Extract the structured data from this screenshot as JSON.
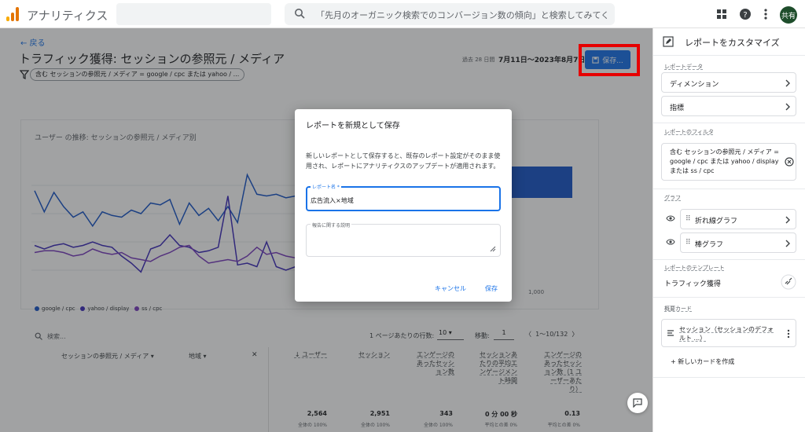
{
  "header": {
    "app_title": "アナリティクス",
    "search_placeholder": "「先月のオーガニック検索でのコンバージョン数の傾向」と検索してみてく...",
    "avatar": "共有"
  },
  "report": {
    "back": "← 戻る",
    "title": "トラフィック獲得: セッションの参照元 / メディア",
    "filter_chip": "含む セッションの参照元 / メディア = google / cpc または yahoo / ...",
    "date_range_label": "過去 28 日間",
    "date_range": "7月11日～2023年8月7日",
    "save_button": "保存..."
  },
  "chart": {
    "title": "ユーザー の推移: セッションの参照元 / メディア別",
    "axis_label_1000": "1,000",
    "legend": [
      "google / cpc",
      "yahoo / display",
      "ss / cpc"
    ]
  },
  "chart_data": {
    "type": "line",
    "title": "ユーザー の推移: セッションの参照元 / メディア別",
    "x": [
      1,
      2,
      3,
      4,
      5,
      6,
      7,
      8,
      9,
      10,
      11,
      12,
      13,
      14,
      15,
      16,
      17,
      18,
      19,
      20,
      21,
      22,
      23,
      24,
      25,
      26,
      27,
      28
    ],
    "series": [
      {
        "name": "google / cpc",
        "color": "#1a57c8",
        "values": [
          122,
          98,
          120,
          104,
          92,
          98,
          82,
          98,
          94,
          92,
          100,
          96,
          108,
          106,
          112,
          84,
          108,
          94,
          102,
          88,
          104,
          86,
          140,
          118,
          116,
          118,
          114,
          116
        ]
      },
      {
        "name": "yahoo / display",
        "color": "#3f2dbb",
        "values": [
          60,
          56,
          60,
          62,
          58,
          60,
          64,
          60,
          58,
          48,
          40,
          30,
          56,
          60,
          72,
          60,
          58,
          52,
          54,
          58,
          116,
          38,
          40,
          36,
          64,
          36,
          32,
          36
        ]
      },
      {
        "name": "ss / cpc",
        "color": "#7b3fbf",
        "values": [
          52,
          54,
          54,
          52,
          48,
          50,
          56,
          52,
          50,
          52,
          46,
          44,
          42,
          48,
          52,
          58,
          60,
          48,
          40,
          42,
          44,
          42,
          48,
          58,
          50,
          52,
          48,
          46
        ]
      }
    ]
  },
  "table": {
    "search": "検索...",
    "rows_per_page_label": "1 ページあたりの行数:",
    "rows_per_page_value": "10",
    "goto_label": "移動:",
    "goto_value": "1",
    "pager": "1～10/132",
    "dim1": "セッションの参照元 / メディア",
    "dim2": "地域",
    "columns": [
      {
        "label": "↓ ユーザー",
        "total": "2,564",
        "pct": "全体の 100%"
      },
      {
        "label": "セッション",
        "total": "2,951",
        "pct": "全体の 100%"
      },
      {
        "label": "エンゲージのあったセッション数",
        "total": "343",
        "pct": "全体の 100%"
      },
      {
        "label": "セッションあたりの平均エンゲージメント時間",
        "total": "0 分 00 秒",
        "pct": "平均との差 0%"
      },
      {
        "label": "エンゲージのあったセッション数（1 ユーザーあたり）",
        "total": "0.13",
        "pct": "平均との差 0%"
      }
    ]
  },
  "dialog": {
    "title": "レポートを新規として保存",
    "text": "新しいレポートとして保存すると、既存のレポート設定がそのまま使用され、レポートにアナリティクスのアップデートが適用されます。",
    "name_label": "レポート名 *",
    "name_value": "広告流入×地域",
    "desc_label": "報告に関する説明",
    "cancel": "キャンセル",
    "save": "保存"
  },
  "panel": {
    "title": "レポートをカスタマイズ",
    "sec_data": "レポートデータ",
    "dimension": "ディメンション",
    "metric": "指標",
    "sec_filter": "レポートのフィルタ",
    "filter_text": "含む セッションの参照元 / メディア = google / cpc または yahoo / display または ss / cpc",
    "sec_graph": "グラフ",
    "graph1": "折れ線グラフ",
    "graph2": "棒グラフ",
    "sec_template": "レポートのテンプレート",
    "template_name": "トラフィック獲得",
    "sec_cards": "概要カード",
    "card_text": "セッション（セッションのデフォルト ...）",
    "add_card": "+ 新しいカードを作成"
  }
}
